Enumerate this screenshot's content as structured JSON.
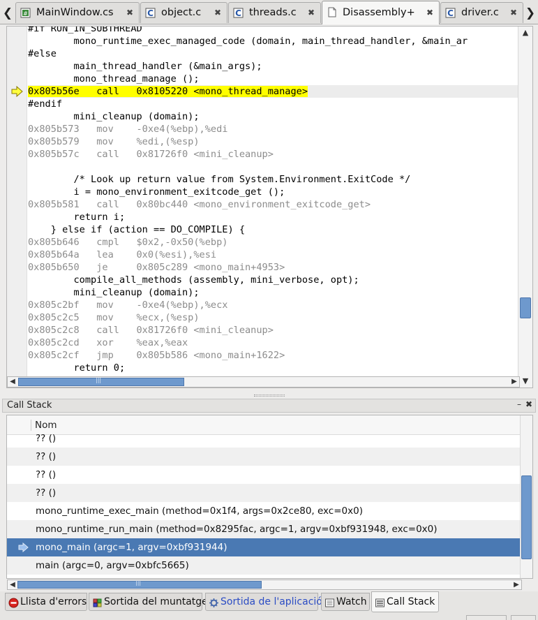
{
  "tabs": [
    {
      "label": "MainWindow.cs",
      "icon": "csharp-file-icon",
      "close": "✖"
    },
    {
      "label": "object.c",
      "icon": "c-file-icon",
      "close": "✖"
    },
    {
      "label": "threads.c",
      "icon": "c-file-icon",
      "close": "✖"
    },
    {
      "label": "Disassembly+",
      "icon": "document-icon",
      "close": "✖"
    },
    {
      "label": "driver.c",
      "icon": "c-file-icon",
      "close": "✖"
    }
  ],
  "tab_nav": {
    "left": "❮",
    "right": "❯"
  },
  "editor": {
    "lines": [
      "#if RUN_IN_SUBTHREAD",
      "        mono_runtime_exec_managed_code (domain, main_thread_handler, &main_ar",
      "#else",
      "        main_thread_handler (&main_args);",
      "        mono_thread_manage ();",
      "0x805b56e   call   0x8105220 <mono_thread_manage>",
      "#endif",
      "        mini_cleanup (domain);",
      "0x805b573   mov    -0xe4(%ebp),%edi",
      "0x805b579   mov    %edi,(%esp)",
      "0x805b57c   call   0x81726f0 <mini_cleanup>",
      "",
      "        /* Look up return value from System.Environment.ExitCode */",
      "        i = mono_environment_exitcode_get ();",
      "0x805b581   call   0x80bc440 <mono_environment_exitcode_get>",
      "        return i;",
      "    } else if (action == DO_COMPILE) {",
      "0x805b646   cmpl   $0x2,-0x50(%ebp)",
      "0x805b64a   lea    0x0(%esi),%esi",
      "0x805b650   je     0x805c289 <mono_main+4953>",
      "        compile_all_methods (assembly, mini_verbose, opt);",
      "        mini_cleanup (domain);",
      "0x805c2bf   mov    -0xe4(%ebp),%ecx",
      "0x805c2c5   mov    %ecx,(%esp)",
      "0x805c2c8   call   0x81726f0 <mini_cleanup>",
      "0x805c2cd   xor    %eax,%eax",
      "0x805c2cf   jmp    0x805b586 <mono_main+1622>",
      "        return 0;"
    ],
    "line_kinds": [
      "src",
      "src",
      "src",
      "src",
      "src",
      "cur",
      "src",
      "src",
      "asm",
      "asm",
      "asm",
      "src",
      "src",
      "src",
      "asm",
      "src",
      "src",
      "asm",
      "asm",
      "asm",
      "src",
      "src",
      "asm",
      "asm",
      "asm",
      "asm",
      "asm",
      "src"
    ],
    "current_line_index": 5,
    "highlight_color": "#ffff00"
  },
  "scroll": {
    "up": "▲",
    "down": "▼",
    "left": "◀",
    "right": "▶",
    "grip": "|||"
  },
  "call_stack": {
    "title": "Call Stack",
    "minimize": "–",
    "close": "✖",
    "column_name": "Nom",
    "frames": [
      "?? ()",
      "?? ()",
      "?? ()",
      "?? ()",
      "mono_runtime_exec_main (method=0x1f4, args=0x2ce80, exc=0x0)",
      "mono_runtime_run_main (method=0x8295fac, argc=1, argv=0xbf931948, exc=0x0)",
      "mono_main (argc=1, argv=0xbf931944)",
      "main (argc=0, argv=0xbfc5665)"
    ],
    "selected_index": 6,
    "selection_color": "#4a79b3"
  },
  "bottom_tabs": [
    {
      "label": "Llista d'errors",
      "icon": "error-icon"
    },
    {
      "label": "Sortida del muntatge",
      "icon": "build-output-icon"
    },
    {
      "label": "Sortida de l'aplicació",
      "icon": "application-output-icon"
    },
    {
      "label": "Watch",
      "icon": "watch-icon"
    },
    {
      "label": "Call Stack",
      "icon": "call-stack-icon"
    }
  ],
  "active_bottom_tab_index": 4
}
